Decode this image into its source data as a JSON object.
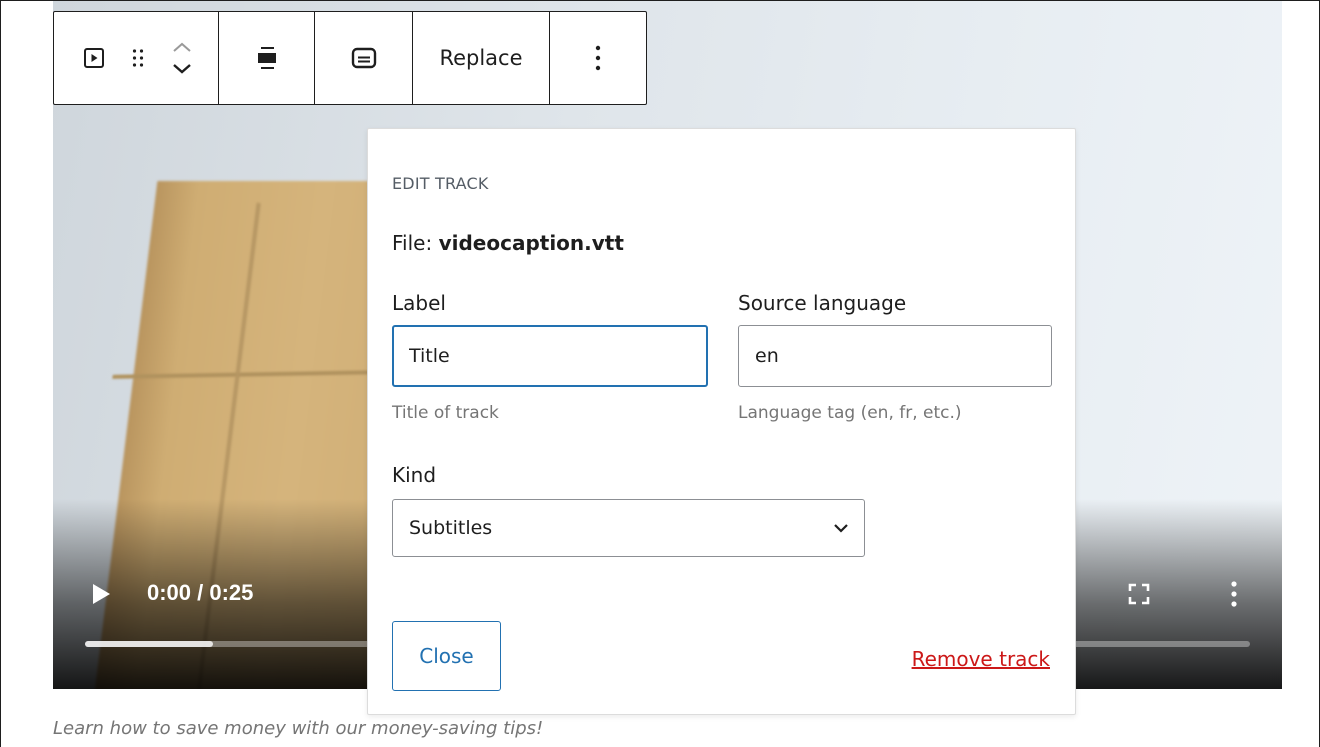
{
  "toolbar": {
    "block_type_icon": "video-block-icon",
    "drag_icon": "drag-handle-icon",
    "move_up_icon": "chevron-up-icon",
    "move_down_icon": "chevron-down-icon",
    "align_icon": "align-icon",
    "captions_icon": "captions-icon",
    "replace_label": "Replace",
    "options_icon": "more-vertical-icon"
  },
  "video": {
    "time_display": "0:00 / 0:25",
    "progress_fraction": 0.11,
    "play_icon": "play-icon",
    "fullscreen_icon": "fullscreen-icon",
    "more_icon": "more-vertical-icon"
  },
  "edit_track": {
    "heading": "EDIT TRACK",
    "file_prefix": "File:",
    "file_name": "videocaption.vtt",
    "label_label": "Label",
    "label_value": "Title",
    "label_help": "Title of track",
    "source_language_label": "Source language",
    "source_language_value": "en",
    "source_language_help": "Language tag (en, fr, etc.)",
    "kind_label": "Kind",
    "kind_value": "Subtitles",
    "close_label": "Close",
    "remove_label": "Remove track"
  },
  "caption": "Learn how to save money with our money-saving tips!",
  "colors": {
    "accent": "#2271b1",
    "destructive": "#cc1818",
    "text": "#1e1e1e",
    "help_text": "#757575"
  }
}
